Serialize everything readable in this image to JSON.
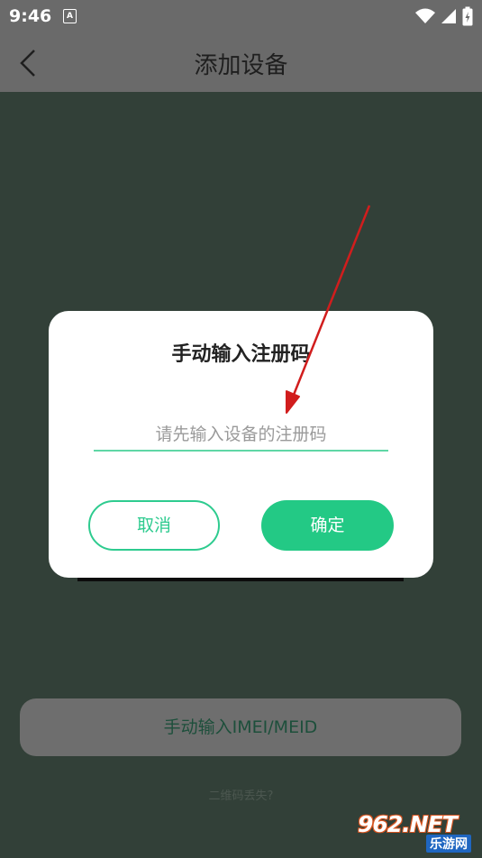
{
  "status_bar": {
    "time": "9:46",
    "notification_badge": "A",
    "icons": [
      "wifi-icon",
      "signal-icon",
      "battery-icon"
    ]
  },
  "app_bar": {
    "back_icon": "chevron-left-icon",
    "title": "添加设备"
  },
  "dialog": {
    "title": "手动输入注册码",
    "input_placeholder": "请先输入设备的注册码",
    "input_value": "",
    "cancel_label": "取消",
    "confirm_label": "确定"
  },
  "main": {
    "manual_imei_label": "手动输入IMEI/MEID",
    "qr_lost_label": "二维码丢失?"
  },
  "watermark": {
    "logo_text": "962.NET",
    "sub_text": "乐游网"
  },
  "colors": {
    "accent": "#23c985",
    "overlay": "#324038",
    "app_bar": "#6a6a6a",
    "arrow": "#d11d1d"
  }
}
